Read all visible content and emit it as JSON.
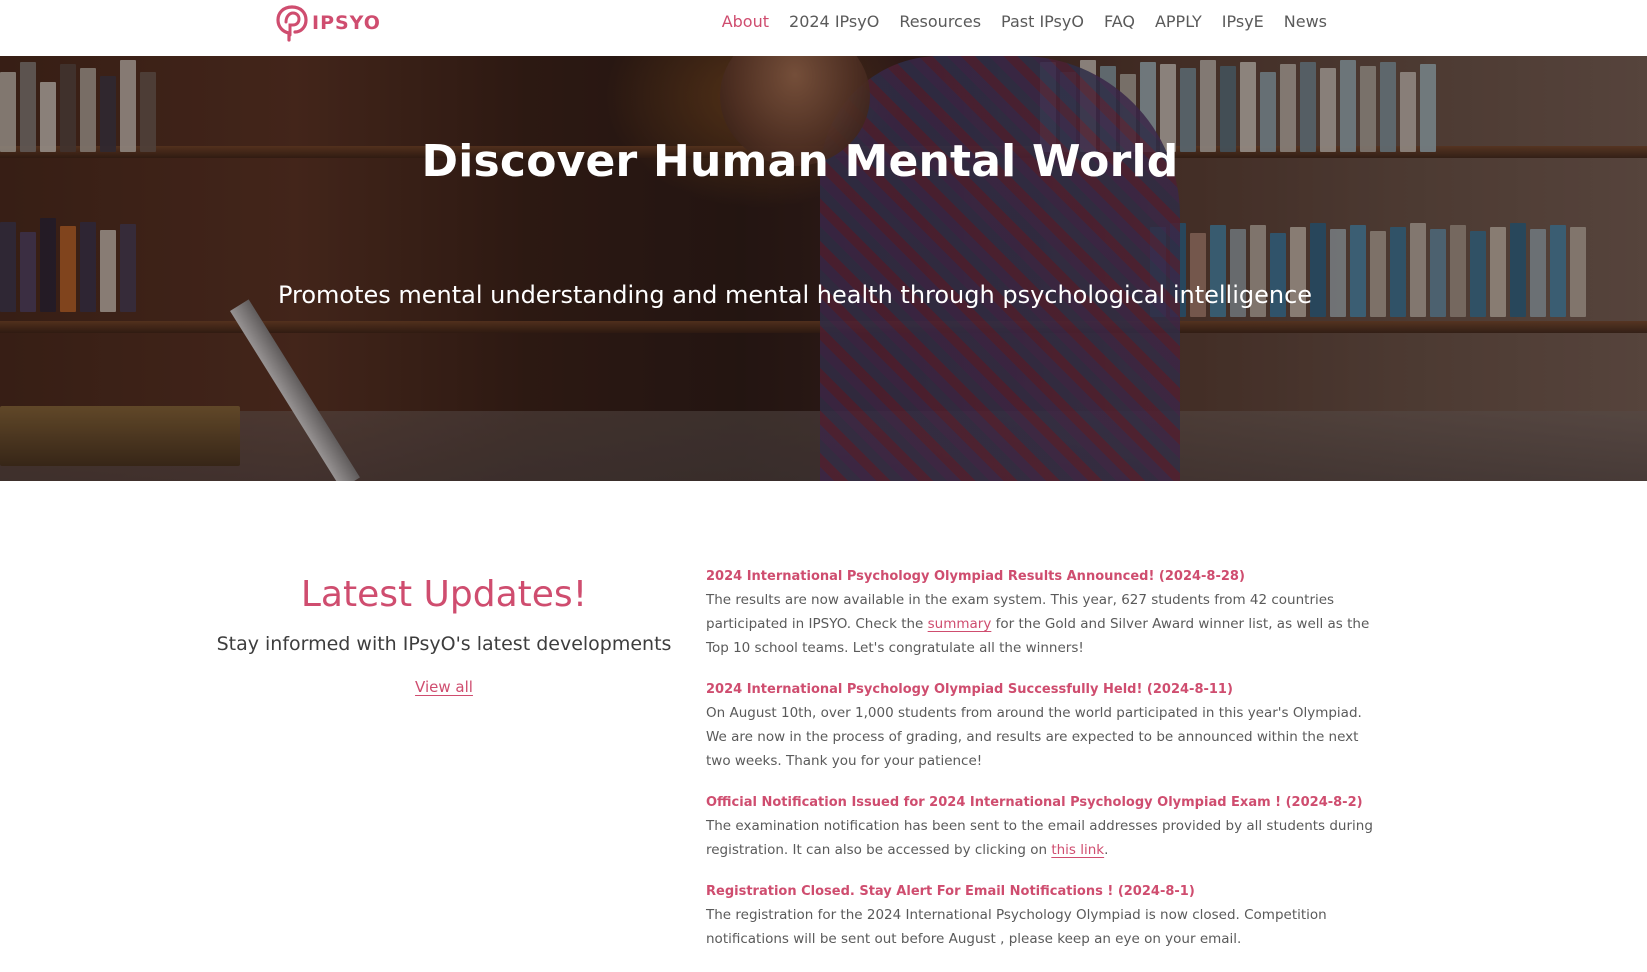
{
  "header": {
    "logo_text": "IPSYO",
    "nav": [
      {
        "label": "About",
        "active": true
      },
      {
        "label": "2024 IPsyO",
        "active": false
      },
      {
        "label": "Resources",
        "active": false
      },
      {
        "label": "Past IPsyO",
        "active": false
      },
      {
        "label": "FAQ",
        "active": false
      },
      {
        "label": "APPLY",
        "active": false
      },
      {
        "label": "IPsyE",
        "active": false
      },
      {
        "label": "News",
        "active": false
      }
    ]
  },
  "hero": {
    "title": "Discover Human Mental World",
    "subtitle": "Promotes mental understanding and mental health through psychological intelligence"
  },
  "updates": {
    "title": "Latest Updates!",
    "subtitle": "Stay informed with IPsyO's latest developments",
    "view_all": "View all",
    "items": [
      {
        "title": "2024 International Psychology Olympiad Results Announced! (2024-8-28)",
        "body_before": "The results are now available in the exam system. This year, 627 students from 42 countries participated in IPSYO. Check the ",
        "link": "summary",
        "body_after": " for the Gold and Silver Award winner list, as well as the Top 10 school teams. Let's congratulate all the winners!"
      },
      {
        "title": "2024 International Psychology Olympiad Successfully Held! (2024-8-11)",
        "body_before": "On August 10th, over 1,000 students from around the world participated in this year's Olympiad. We are now in the process of grading, and results are expected to be announced within the next two weeks. Thank you for your patience!",
        "link": "",
        "body_after": ""
      },
      {
        "title": "Official Notification Issued for 2024 International Psychology Olympiad Exam ! (2024-8-2)",
        "body_before": "The examination notification has been sent to the email addresses provided by all students during registration. It can also be accessed by clicking on ",
        "link": "this link",
        "body_after": "."
      },
      {
        "title": "Registration Closed. Stay Alert For Email Notifications ! (2024-8-1)",
        "body_before": "The registration for the 2024 International Psychology Olympiad is now closed. Competition notifications will be sent out before August , please keep an eye on your email.",
        "link": "",
        "body_after": ""
      }
    ]
  },
  "colors": {
    "accent": "#cf4d6f",
    "text": "#5a5a5a",
    "heading_dark": "#3d3d3d"
  }
}
